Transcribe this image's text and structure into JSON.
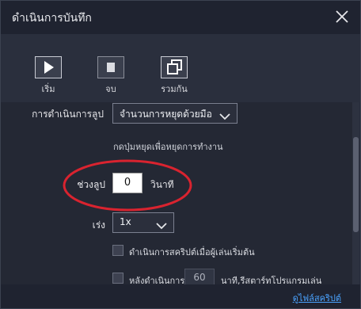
{
  "window": {
    "title": "ดำเนินการบันทึก"
  },
  "toolbar": {
    "start_label": "เริ่ม",
    "stop_label": "จบ",
    "merge_label": "รวมกัน"
  },
  "settings": {
    "loop_mode_label": "การดำเนินการลูป",
    "loop_mode_value": "จำนวนการหยุดด้วยมือ",
    "loop_hint": "กดปุ่มหยุดเพื่อหยุดการทำงาน",
    "loop_interval_label": "ช่วงลูป",
    "loop_interval_value": "0",
    "loop_interval_unit": "วินาที",
    "speed_label": "เร่ง",
    "speed_value": "1x",
    "run_on_start_text": "ดำเนินการสคริปต์เมื่อผู้เล่นเริ่มต้น",
    "restart_prefix": "หลังดำเนินการ",
    "restart_minutes": "60",
    "restart_suffix": "นาที,รีสตาร์ทโปรแกรมเล่น"
  },
  "footer": {
    "link_text": "ดูไฟล์สคริปต์"
  },
  "colors": {
    "accent_link": "#4aa3ff",
    "highlight_ellipse": "#d9232f"
  }
}
